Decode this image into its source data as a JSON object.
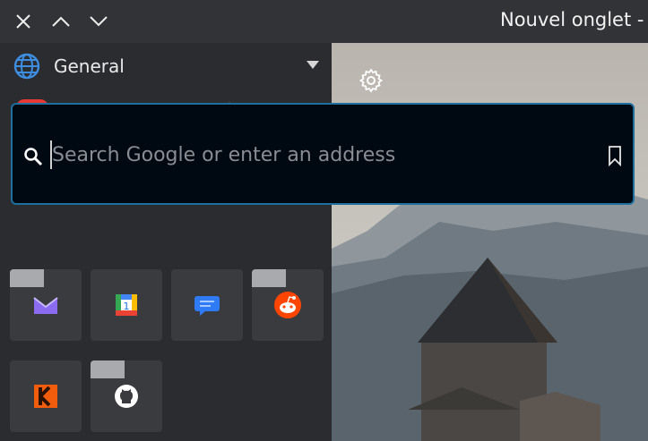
{
  "window": {
    "title": "Nouvel onglet -"
  },
  "sidebar": {
    "workspace_label": "General"
  },
  "search": {
    "placeholder": "Search Google or enter an address",
    "value": ""
  },
  "shortcuts": [
    {
      "name": "proton-mail",
      "icon": "proton-mail-icon",
      "tag": true
    },
    {
      "name": "google-calendar",
      "icon": "calendar-icon",
      "tag": false
    },
    {
      "name": "messages",
      "icon": "messages-icon",
      "tag": false
    },
    {
      "name": "reddit",
      "icon": "reddit-icon",
      "tag": true
    },
    {
      "name": "kodi",
      "icon": "kodi-icon",
      "tag": false
    },
    {
      "name": "github",
      "icon": "github-icon",
      "tag": true
    }
  ],
  "colors": {
    "accent": "#1e6e9e",
    "app_icon": "#e53935",
    "panel": "#2b2c30",
    "tile": "#3a3b3f"
  }
}
